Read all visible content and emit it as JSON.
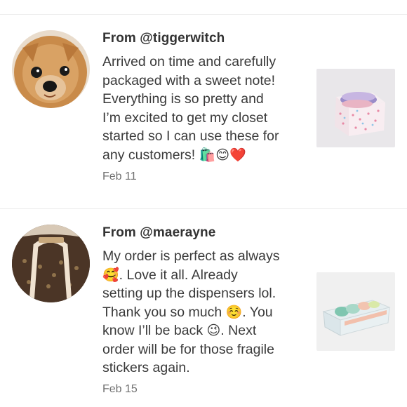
{
  "reviews": [
    {
      "author": "From @tiggerwitch",
      "lines": [
        {
          "text": "Arrived on time and carefully"
        },
        {
          "text": "packaged with a sweet note!"
        },
        {
          "text": "Everything is so pretty and"
        },
        {
          "text": "I’m excited to get my closet"
        },
        {
          "text": "started so I can use these for"
        },
        {
          "text": "any customers! ",
          "emoji": "🛍️😊❤️"
        }
      ],
      "date": "Feb 11",
      "avatar_icon": "pomeranian-dog-photo",
      "thumbnail_icon": "washi-tape-gift-box-photo"
    },
    {
      "author": "From @maerayne",
      "lines": [
        {
          "text": "My order is perfect as always"
        },
        {
          "emoji": "🥰",
          "text": ". Love it all. Already"
        },
        {
          "text": "setting up the dispensers lol."
        },
        {
          "text": "Thank you so much ",
          "emoji": "☺️",
          "text2": ". You"
        },
        {
          "text": "know I’ll be back ",
          "emoji": "😉",
          "text2": ". Next"
        },
        {
          "text": "order will be for those fragile"
        },
        {
          "text": "stickers again."
        }
      ],
      "date": "Feb 15",
      "avatar_icon": "monogram-handbag-photo",
      "thumbnail_icon": "tape-dispenser-photo"
    }
  ]
}
